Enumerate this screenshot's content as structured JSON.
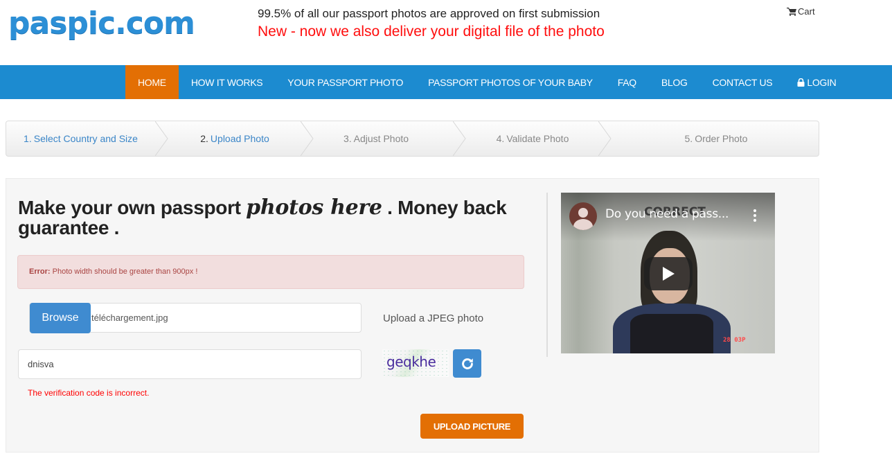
{
  "header": {
    "logo": "paspic.com",
    "tagline": "99.5% of all our passport photos are approved on first submission",
    "announcement": "New - now we also deliver your digital file of the photo",
    "cart_label": "Cart",
    "cart_icon": "shopping-cart-icon"
  },
  "colors": {
    "brand_blue": "#1c8bd0",
    "accent_orange": "#e36f04",
    "error_red": "#ff0000",
    "alert_bg": "#f2dede"
  },
  "nav": {
    "items": [
      {
        "label": "HOME",
        "active": true
      },
      {
        "label": "HOW IT WORKS"
      },
      {
        "label": "YOUR PASSPORT PHOTO"
      },
      {
        "label": "PASSPORT PHOTOS OF YOUR BABY"
      },
      {
        "label": "FAQ"
      },
      {
        "label": "BLOG"
      },
      {
        "label": "CONTACT US"
      },
      {
        "label": "LOGIN",
        "icon": "lock-icon"
      }
    ]
  },
  "wizard": {
    "current_step": 2,
    "steps": [
      {
        "num": "1.",
        "label": "Select Country and Size"
      },
      {
        "num": "2.",
        "label": "Upload Photo"
      },
      {
        "num": "3.",
        "label": "Adjust Photo"
      },
      {
        "num": "4.",
        "label": "Validate Photo"
      },
      {
        "num": "5.",
        "label": "Order Photo"
      }
    ]
  },
  "main": {
    "headline_before": "Make your own passport ",
    "headline_script": "photos here",
    "headline_after": " . Money back guarantee .",
    "alert": {
      "label": "Error:",
      "message": " Photo width should be greater than 900px !"
    },
    "file_input": {
      "button_label": "Browse",
      "filename": "téléchargement.jpg",
      "hint": "Upload a JPEG photo"
    },
    "captcha": {
      "value": "dnisva",
      "image_text": "geqkhe",
      "refresh_icon": "refresh-icon",
      "error": "The verification code is incorrect."
    },
    "submit_label": "UPLOAD PICTURE"
  },
  "video": {
    "title": "Do you need a pass...",
    "background_text": "CORRECT",
    "play_icon": "play-icon",
    "menu_icon": "more-vert-icon"
  }
}
